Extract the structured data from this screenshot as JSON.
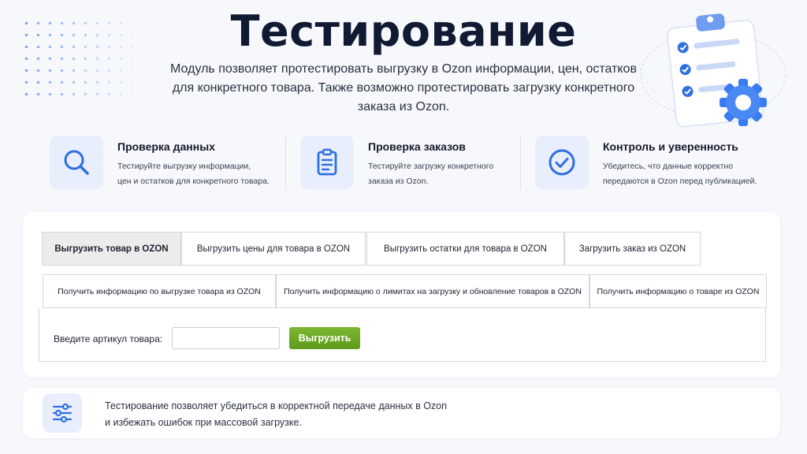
{
  "header": {
    "title": "Тестирование",
    "subtitle": "Модуль позволяет протестировать выгрузку в Ozon информации, цен, остатков для конкретного товара. Также возможно протестировать загрузку конкретного заказа из Ozon."
  },
  "features": [
    {
      "icon": "search-icon",
      "title": "Проверка данных",
      "desc_line1": "Тестируйте выгрузку информации,",
      "desc_line2": "цен и остатков для конкретного товара."
    },
    {
      "icon": "clipboard-icon",
      "title": "Проверка заказов",
      "desc_line1": "Тестируйте загрузку конкретного",
      "desc_line2": "заказа из Ozon."
    },
    {
      "icon": "check-circle-icon",
      "title": "Контроль и уверенность",
      "desc_line1": "Убедитесь, что данные корректно",
      "desc_line2": "передаются в Ozon перед публикацией."
    }
  ],
  "tabs_row1": [
    {
      "label": "Выгрузить товар в OZON",
      "active": true
    },
    {
      "label": "Выгрузить цены для товара в OZON",
      "active": false
    },
    {
      "label": "Выгрузить остатки для товара в OZON",
      "active": false
    },
    {
      "label": "Загрузить заказ из OZON",
      "active": false
    }
  ],
  "tabs_row2": [
    {
      "label": "Получить информацию по выгрузке товара из OZON",
      "active": false
    },
    {
      "label": "Получить информацию о лимитах на загрузку и обновление товаров в OZON",
      "active": false
    },
    {
      "label": "Получить информацию о товаре из OZON",
      "active": false
    }
  ],
  "form": {
    "label": "Введите артикул товара:",
    "value": "",
    "placeholder": "",
    "button": "Выгрузить"
  },
  "info": {
    "icon": "sliders-icon",
    "line1": "Тестирование позволяет убедиться в корректной передаче данных в Ozon",
    "line2": "и избежать ошибок при массовой загрузке."
  },
  "colors": {
    "accent": "#2f6fe4",
    "button_green": "#6aa823",
    "icon_bg": "#e8eefb"
  }
}
